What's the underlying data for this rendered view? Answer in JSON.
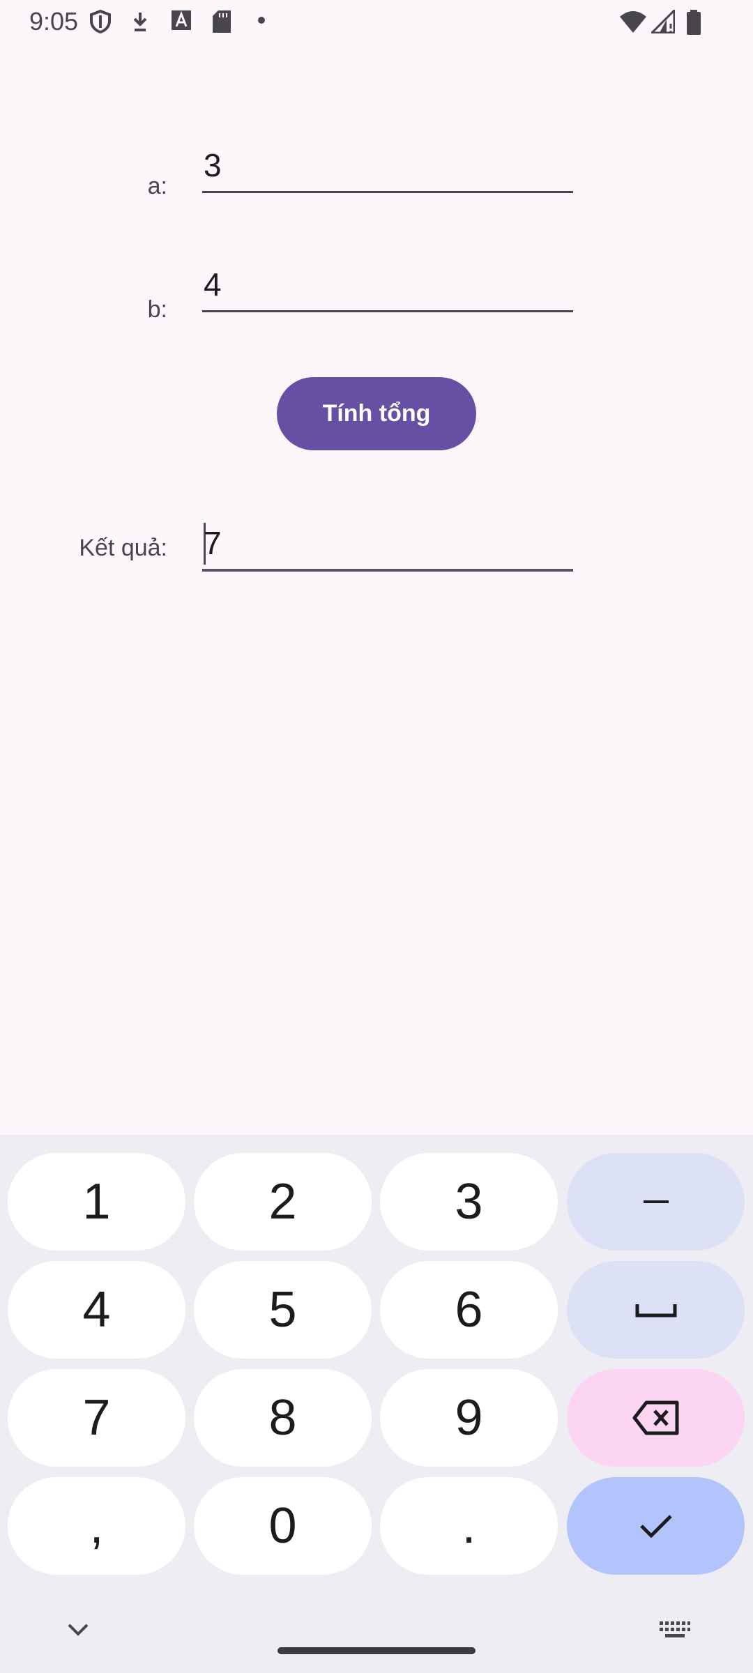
{
  "status_bar": {
    "time": "9:05",
    "icons": [
      "shield-icon",
      "download-icon",
      "text-a-icon",
      "sd-card-icon",
      "dot-icon",
      "wifi-icon",
      "signal-icon",
      "battery-icon"
    ]
  },
  "form": {
    "a_label": "a:",
    "a_value": "3",
    "b_label": "b:",
    "b_value": "4",
    "sum_button": "Tính tổng",
    "result_label": "Kết quả:",
    "result_value": "7"
  },
  "keyboard": {
    "keys": [
      "1",
      "2",
      "3",
      "–",
      "4",
      "5",
      "6",
      "␣",
      "7",
      "8",
      "9",
      "⌫",
      ",",
      "0",
      ".",
      "✓"
    ]
  },
  "colors": {
    "background": "#fdf7fc",
    "primary": "#6750a4",
    "keyboard_bg": "#efedf4"
  }
}
